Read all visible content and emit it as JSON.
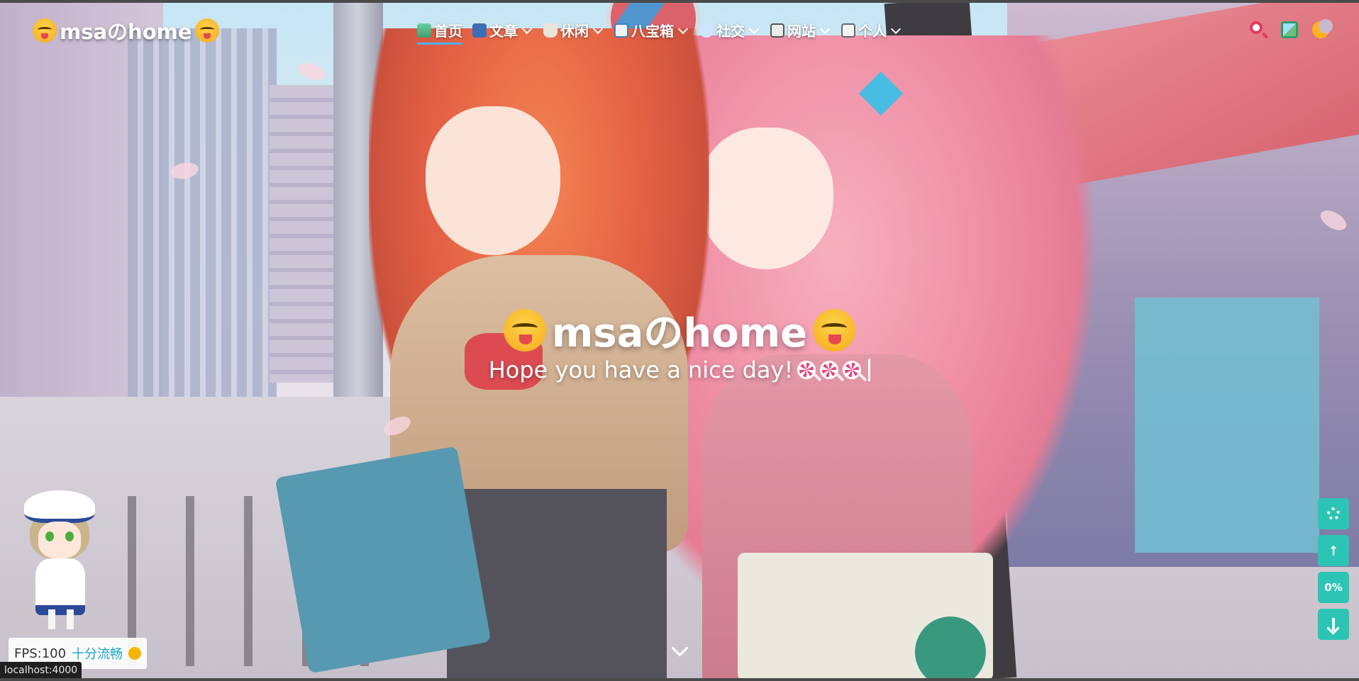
{
  "site": {
    "logo_text": "msaのhome",
    "accent_color": "#49b1f5",
    "side_button_color": "#2cc5b5"
  },
  "nav": {
    "menu": [
      {
        "label": "首页",
        "icon": "home-icon",
        "has_dropdown": false,
        "active": true
      },
      {
        "label": "文章",
        "icon": "book-icon",
        "has_dropdown": true,
        "active": false
      },
      {
        "label": "休闲",
        "icon": "coffee-icon",
        "has_dropdown": true,
        "active": false
      },
      {
        "label": "八宝箱",
        "icon": "toolbox-icon",
        "has_dropdown": true,
        "active": false
      },
      {
        "label": "社交",
        "icon": "chat-icon",
        "has_dropdown": true,
        "active": false
      },
      {
        "label": "网站",
        "icon": "website-icon",
        "has_dropdown": true,
        "active": false
      },
      {
        "label": "个人",
        "icon": "profile-icon",
        "has_dropdown": true,
        "active": false
      }
    ],
    "right_icons": [
      "search-icon",
      "wallpaper-icon",
      "dark-mode-moon-icon"
    ]
  },
  "hero": {
    "title": "msaのhome",
    "subtitle": "Hope you have a nice day!",
    "subtitle_emojis": [
      "lollipop-icon",
      "lollipop-icon",
      "lollipop-icon"
    ],
    "scroll_down_icon": "chevron-down-icon"
  },
  "side_buttons": [
    {
      "name": "settings-button",
      "icon": "gear-icon",
      "label": ""
    },
    {
      "name": "share-button",
      "icon": "share-icon",
      "label": ""
    },
    {
      "name": "reading-progress-button",
      "icon": "",
      "label": "0%"
    },
    {
      "name": "scroll-to-bottom-button",
      "icon": "arrow-down-icon",
      "label": ""
    }
  ],
  "fps_widget": {
    "fps_label": "FPS:100",
    "status": "十分流畅"
  },
  "status_bar": {
    "url": "localhost:4000"
  }
}
